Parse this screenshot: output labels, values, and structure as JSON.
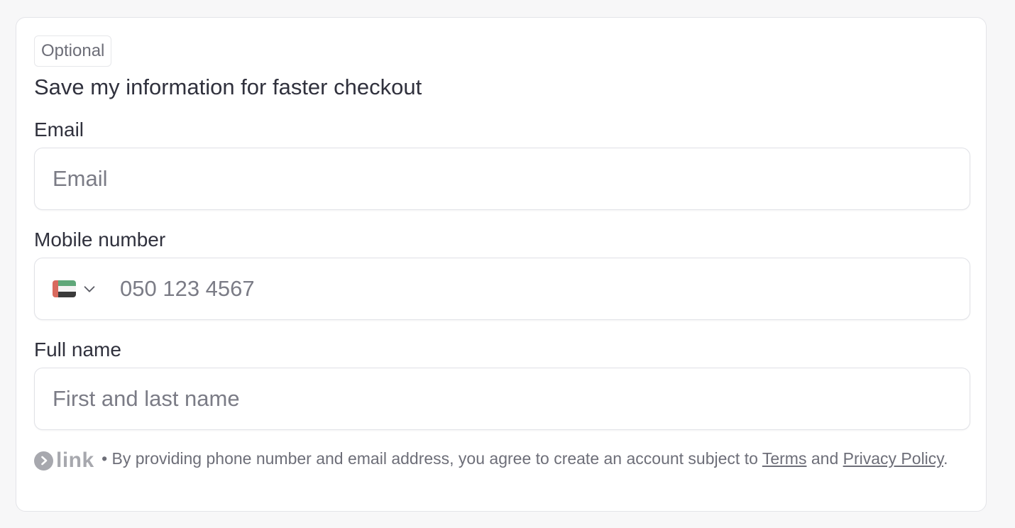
{
  "form": {
    "badge": "Optional",
    "heading": "Save my information for faster checkout",
    "email": {
      "label": "Email",
      "placeholder": "Email",
      "value": ""
    },
    "mobile": {
      "label": "Mobile number",
      "placeholder": "050 123 4567",
      "value": "",
      "country_flag": "uae-flag-icon"
    },
    "full_name": {
      "label": "Full name",
      "placeholder": "First and last name",
      "value": ""
    }
  },
  "footer": {
    "logo_text": "link",
    "separator": "•",
    "text_before": "By providing phone number and email address, you agree to create an account subject to",
    "terms_link": "Terms",
    "and": "and",
    "privacy_link": "Privacy Policy",
    "end": "."
  },
  "colors": {
    "text": "#30313d",
    "muted": "#6d6e78",
    "placeholder": "#7b7c86",
    "border": "#e0e1e6",
    "logo_gray": "#a7a8ae"
  }
}
